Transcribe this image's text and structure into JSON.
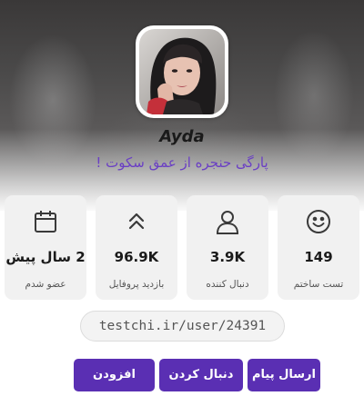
{
  "profile": {
    "username": "Ayda",
    "bio": "پارگی حنجره از عمق سکوت !",
    "avatar_alt": "profile-photo"
  },
  "stats": [
    {
      "icon": "calendar-icon",
      "value": "2 سال پیش",
      "label": "عضو شدم"
    },
    {
      "icon": "chevrons-up-icon",
      "value": "96.9K",
      "label": "بازدید پروفایل"
    },
    {
      "icon": "user-icon",
      "value": "3.9K",
      "label": "دنبال کننده"
    },
    {
      "icon": "smiley-icon",
      "value": "149",
      "label": "تست ساختم"
    }
  ],
  "profile_url": "testchi.ir/user/24391",
  "actions": {
    "add_friend": "افزودن دوست",
    "follow": "دنبال کردن",
    "send_message": "ارسال پیام"
  },
  "colors": {
    "accent": "#5a2fb3",
    "bio_text": "#6a3fc4",
    "card_bg": "#f1f1f1"
  }
}
